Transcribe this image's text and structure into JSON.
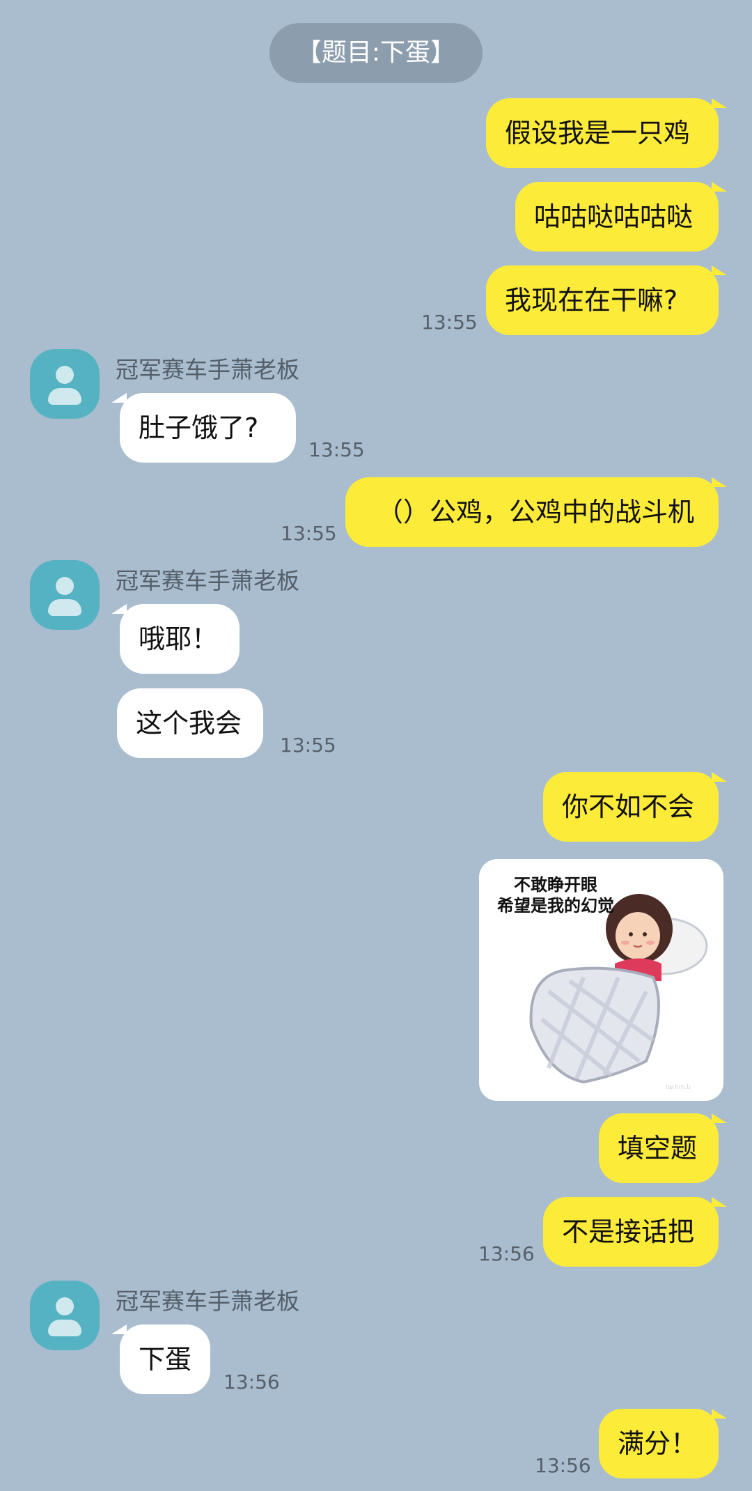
{
  "chat_title": "【题目:下蛋】",
  "messages": {
    "m1": "假设我是一只鸡",
    "m2": "咕咕哒咕咕哒",
    "m3": "我现在在干嘛?",
    "t1": "13:55",
    "sender1": "冠军赛车手萧老板",
    "m4": "肚子饿了?",
    "t2": "13:55",
    "m5": "（）公鸡，公鸡中的战斗机",
    "t3": "13:55",
    "sender2": "冠军赛车手萧老板",
    "m6": "哦耶！",
    "m7": "这个我会",
    "t4": "13:55",
    "m8": "你不如不会",
    "sticker_line1": "不敢睁开眼",
    "sticker_line2": "希望是我的幻觉",
    "m9": "填空题",
    "m10": "不是接话把",
    "t5": "13:56",
    "sender3": "冠军赛车手萧老板",
    "m11": "下蛋",
    "t6": "13:56",
    "m12": "满分！",
    "t7": "13:56"
  },
  "colors": {
    "background": "#a9bdcf",
    "outgoing_bubble": "#fdeb3a",
    "incoming_bubble": "#ffffff",
    "avatar": "#55b2c2",
    "title_pill": "#8c9eae"
  }
}
